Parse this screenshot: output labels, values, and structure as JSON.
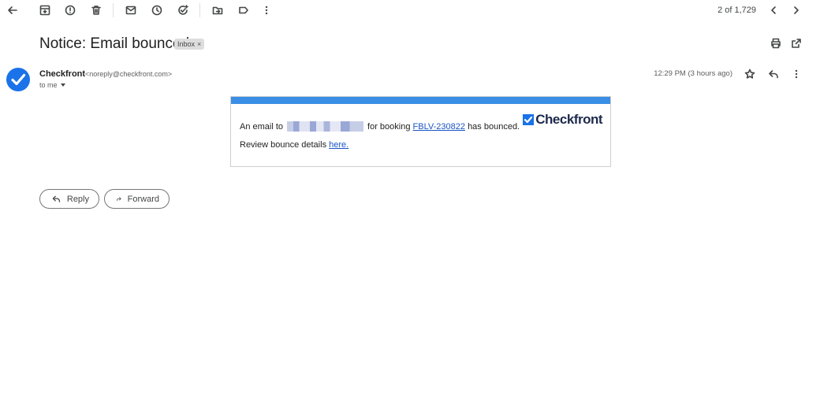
{
  "toolbar": {
    "counter": "2 of 1,729",
    "icons": [
      "back-arrow-icon",
      "archive-icon",
      "report-spam-icon",
      "delete-icon",
      "mark-unread-icon",
      "snooze-icon",
      "add-task-icon",
      "move-to-icon",
      "label-icon",
      "more-vert-icon",
      "chevron-left-icon",
      "chevron-right-icon"
    ]
  },
  "message": {
    "subject": "Notice: Email bounced",
    "label": "Inbox",
    "label_remove": "×",
    "sender_name": "Checkfront",
    "sender_email": "<noreply@checkfront.com>",
    "recipient": "to me",
    "timestamp": "12:29 PM (3 hours ago)"
  },
  "body": {
    "line1_prefix": "An email to",
    "line1_mid": "for booking",
    "booking_link": "FBLV-230822",
    "line1_suffix": "has bounced.",
    "line2_prefix": "Review bounce details",
    "line2_link": "here.",
    "brand_name": "Checkfront",
    "accent_color": "#3a8ee6"
  },
  "actions": {
    "reply_label": "Reply",
    "forward_label": "Forward"
  }
}
